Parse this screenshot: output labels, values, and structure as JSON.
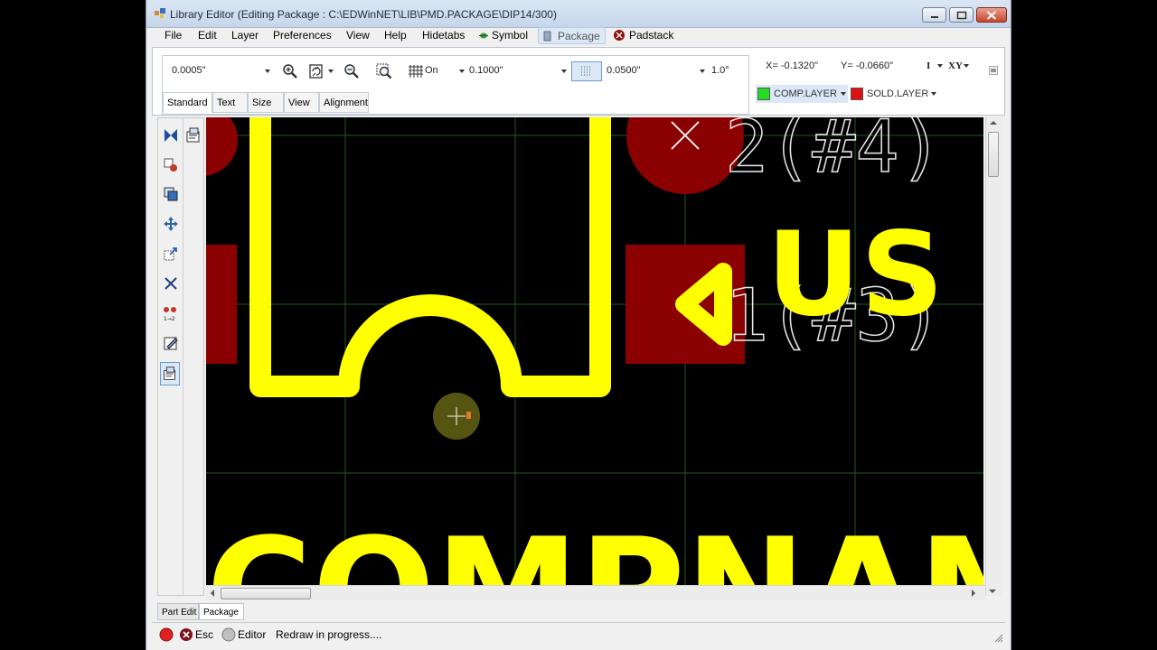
{
  "window": {
    "title": "Library Editor (Editing Package : C:\\EDWinNET\\LIB\\PMD.PACKAGE\\DIP14/300)"
  },
  "menu": {
    "file": "File",
    "edit": "Edit",
    "layer": "Layer",
    "preferences": "Preferences",
    "view": "View",
    "help": "Help",
    "hidetabs": "Hidetabs",
    "symbol": "Symbol",
    "package": "Package",
    "padstack": "Padstack",
    "active_tab": "Package"
  },
  "toolbar": {
    "snap_value": "0.0005\"",
    "grid_state": "On",
    "grid_spacing": "0.1000\"",
    "fine_grid": "0.0500\"",
    "angle": "1.0°",
    "tabs": [
      "Standard",
      "Text",
      "Size",
      "View",
      "Alignment"
    ],
    "active_tab": "Standard"
  },
  "coords": {
    "x": "X= -0.1320\"",
    "y": "Y= -0.0660\"",
    "mode_i": "I",
    "mode_xy": "XY"
  },
  "layers": {
    "primary": {
      "name": "COMP.LAYER",
      "color": "#22dd22"
    },
    "secondary": {
      "name": "SOLD.LAYER",
      "color": "#dd1111"
    }
  },
  "canvas": {
    "labels": {
      "compname": "COMPNAME",
      "us": "US",
      "pin_ref_top": "2(#4)",
      "pin_ref_mid": "1(#3)"
    },
    "colors": {
      "background": "#000000",
      "grid": "#1f5a1f",
      "silkscreen": "#ffff00",
      "pad": "#8b0000",
      "ref_text": "#e8e8e8"
    }
  },
  "bottom_tabs": [
    "Part Edit",
    "Package"
  ],
  "bottom_active": "Package",
  "status": {
    "esc": "Esc",
    "editor": "Editor",
    "message": "Redraw in progress...."
  }
}
